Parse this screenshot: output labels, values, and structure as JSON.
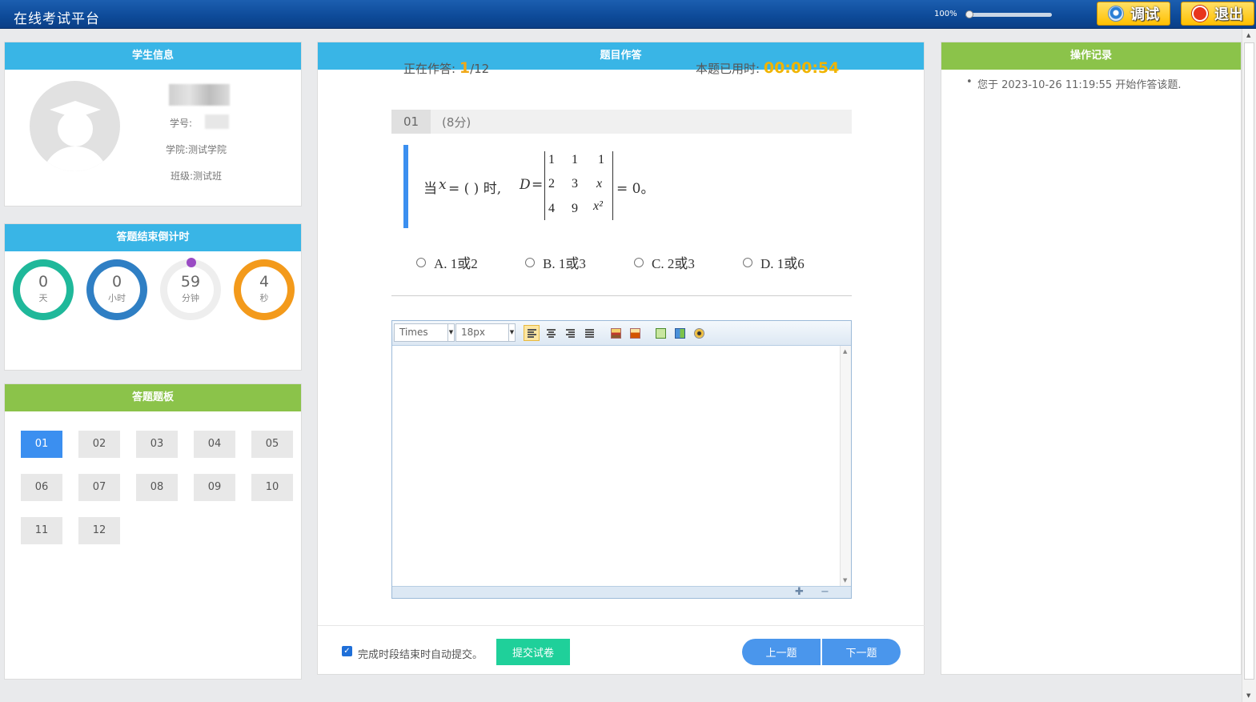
{
  "header": {
    "title": "在线考试平台",
    "zoom": "100%",
    "zoom_level": 0.02,
    "debug_label": "调试",
    "logout_label": "退出"
  },
  "student": {
    "title": "学生信息",
    "id_label": "学号:",
    "college": "学院:测试学院",
    "class": "班级:测试班"
  },
  "countdown": {
    "title": "答题结束倒计时",
    "units": [
      {
        "value": "0",
        "label": "天",
        "color": "#1fb89a"
      },
      {
        "value": "0",
        "label": "小时",
        "color": "#2f7fc4"
      },
      {
        "value": "59",
        "label": "分钟",
        "color": "#eeeeee"
      },
      {
        "value": "4",
        "label": "秒",
        "color": "#f39a1b"
      }
    ]
  },
  "board": {
    "title": "答题题板",
    "items": [
      "01",
      "02",
      "03",
      "04",
      "05",
      "06",
      "07",
      "08",
      "09",
      "10",
      "11",
      "12"
    ],
    "active": "01"
  },
  "question": {
    "title": "题目作答",
    "progress_label": "正在作答:",
    "current": "1",
    "total": "/12",
    "time_label": "本题已用时:",
    "time_value": "00:00:54",
    "number": "01",
    "score": "(8分)",
    "stem_prefix": "当",
    "stem_var": "x",
    "stem_mid": "= (    ) 时,",
    "stem_D": "D",
    "stem_eq": "=",
    "stem_suffix": "= 0。",
    "matrix": [
      [
        "1",
        "1",
        "1"
      ],
      [
        "2",
        "3",
        "x"
      ],
      [
        "4",
        "9",
        "x²"
      ]
    ],
    "options": [
      "A. 1或2",
      "B. 1或3",
      "C. 2或3",
      "D. 1或6"
    ]
  },
  "editor": {
    "font": "Times",
    "size": "18px"
  },
  "footer": {
    "auto_submit": "完成时段结束时自动提交。",
    "submit": "提交试卷",
    "prev": "上一题",
    "next": "下一题"
  },
  "log": {
    "title": "操作记录",
    "entries": [
      "您于 2023-10-26  11:19:55 开始作答该题."
    ]
  }
}
